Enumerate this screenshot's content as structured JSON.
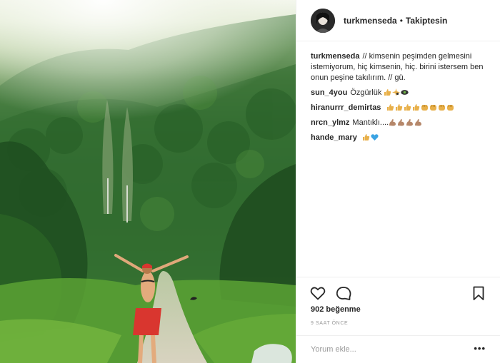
{
  "post": {
    "photo": {
      "icon": "forest-path-photo",
      "colors": {
        "sky": "#f4f7ee",
        "forest_dark": "#2c6a2c",
        "forest_light": "#5b9a35",
        "skirt": "#d9362f",
        "path": "#cfcab5"
      }
    }
  },
  "header": {
    "username": "turkmenseda",
    "separator": "•",
    "follow_status": "Takiptesin"
  },
  "caption": {
    "username": "turkmenseda",
    "text": "// kimsenin peşimden gelmesini istemiyorum, hiç kimsenin, hiç. birini istersem ben onun peşine takılırım. // gü."
  },
  "comments": [
    {
      "username": "sun_4you",
      "text": "Özgürlük",
      "emojis": [
        "thumbs-up",
        "sparkle-bird",
        "eye-face"
      ]
    },
    {
      "username": "hiranurrr_demirtas",
      "text": "",
      "emojis": [
        "thumbs-up",
        "thumbs-up",
        "thumbs-up",
        "thumbs-up",
        "fist",
        "fist",
        "fist",
        "fist"
      ]
    },
    {
      "username": "nrcn_ylmz",
      "text": "Mantıklı....",
      "emojis": [
        "flexed-biceps",
        "flexed-biceps",
        "flexed-biceps",
        "flexed-biceps"
      ]
    },
    {
      "username": "hande_mary",
      "text": "",
      "emojis": [
        "thumbs-up",
        "blue-heart"
      ]
    }
  ],
  "actions": {
    "like_icon": "heart-icon",
    "comment_icon": "comment-icon",
    "save_icon": "bookmark-icon"
  },
  "likes": "902 beğenme",
  "timestamp": "9 SAAT ÖNCE",
  "add_comment": {
    "placeholder": "Yorum ekle...",
    "more": "•••"
  },
  "colors": {
    "text": "#262626",
    "muted": "#999999",
    "border": "#efefef",
    "emoji_skin": "#e8b04a",
    "emoji_heart": "#3aa3e3"
  }
}
